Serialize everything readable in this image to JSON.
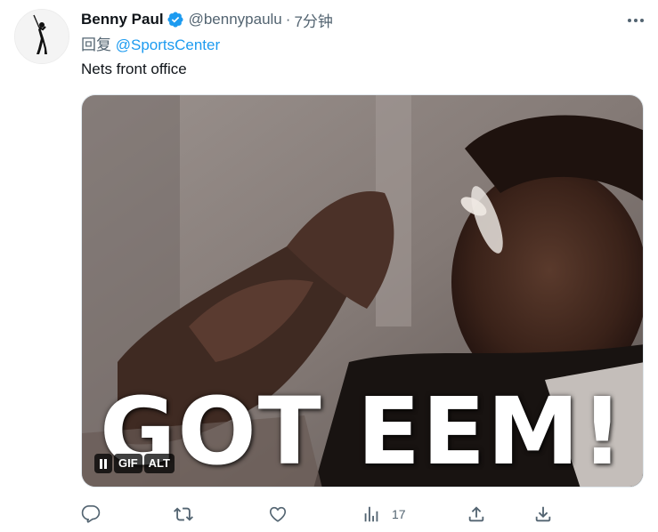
{
  "tweet": {
    "display_name": "Benny Paul",
    "handle": "@bennypaulu",
    "separator": "·",
    "time": "7分钟",
    "reply_prefix": "回复 ",
    "reply_mention": "@SportsCenter",
    "text": "Nets front office",
    "media": {
      "type": "gif",
      "caption": "GOT EEM!",
      "controls": {
        "gif_label": "GIF",
        "alt_label": "ALT"
      }
    },
    "actions": {
      "reply_icon": "comment-icon",
      "retweet_icon": "retweet-icon",
      "like_icon": "heart-icon",
      "views_icon": "views-chart-icon",
      "views_count": "17",
      "share_icon": "share-upload-icon",
      "download_icon": "download-icon"
    }
  },
  "colors": {
    "verified_badge": "#1d9bf0",
    "mention": "#1d9bf0",
    "secondary_text": "#536471",
    "primary_text": "#0f1419"
  }
}
